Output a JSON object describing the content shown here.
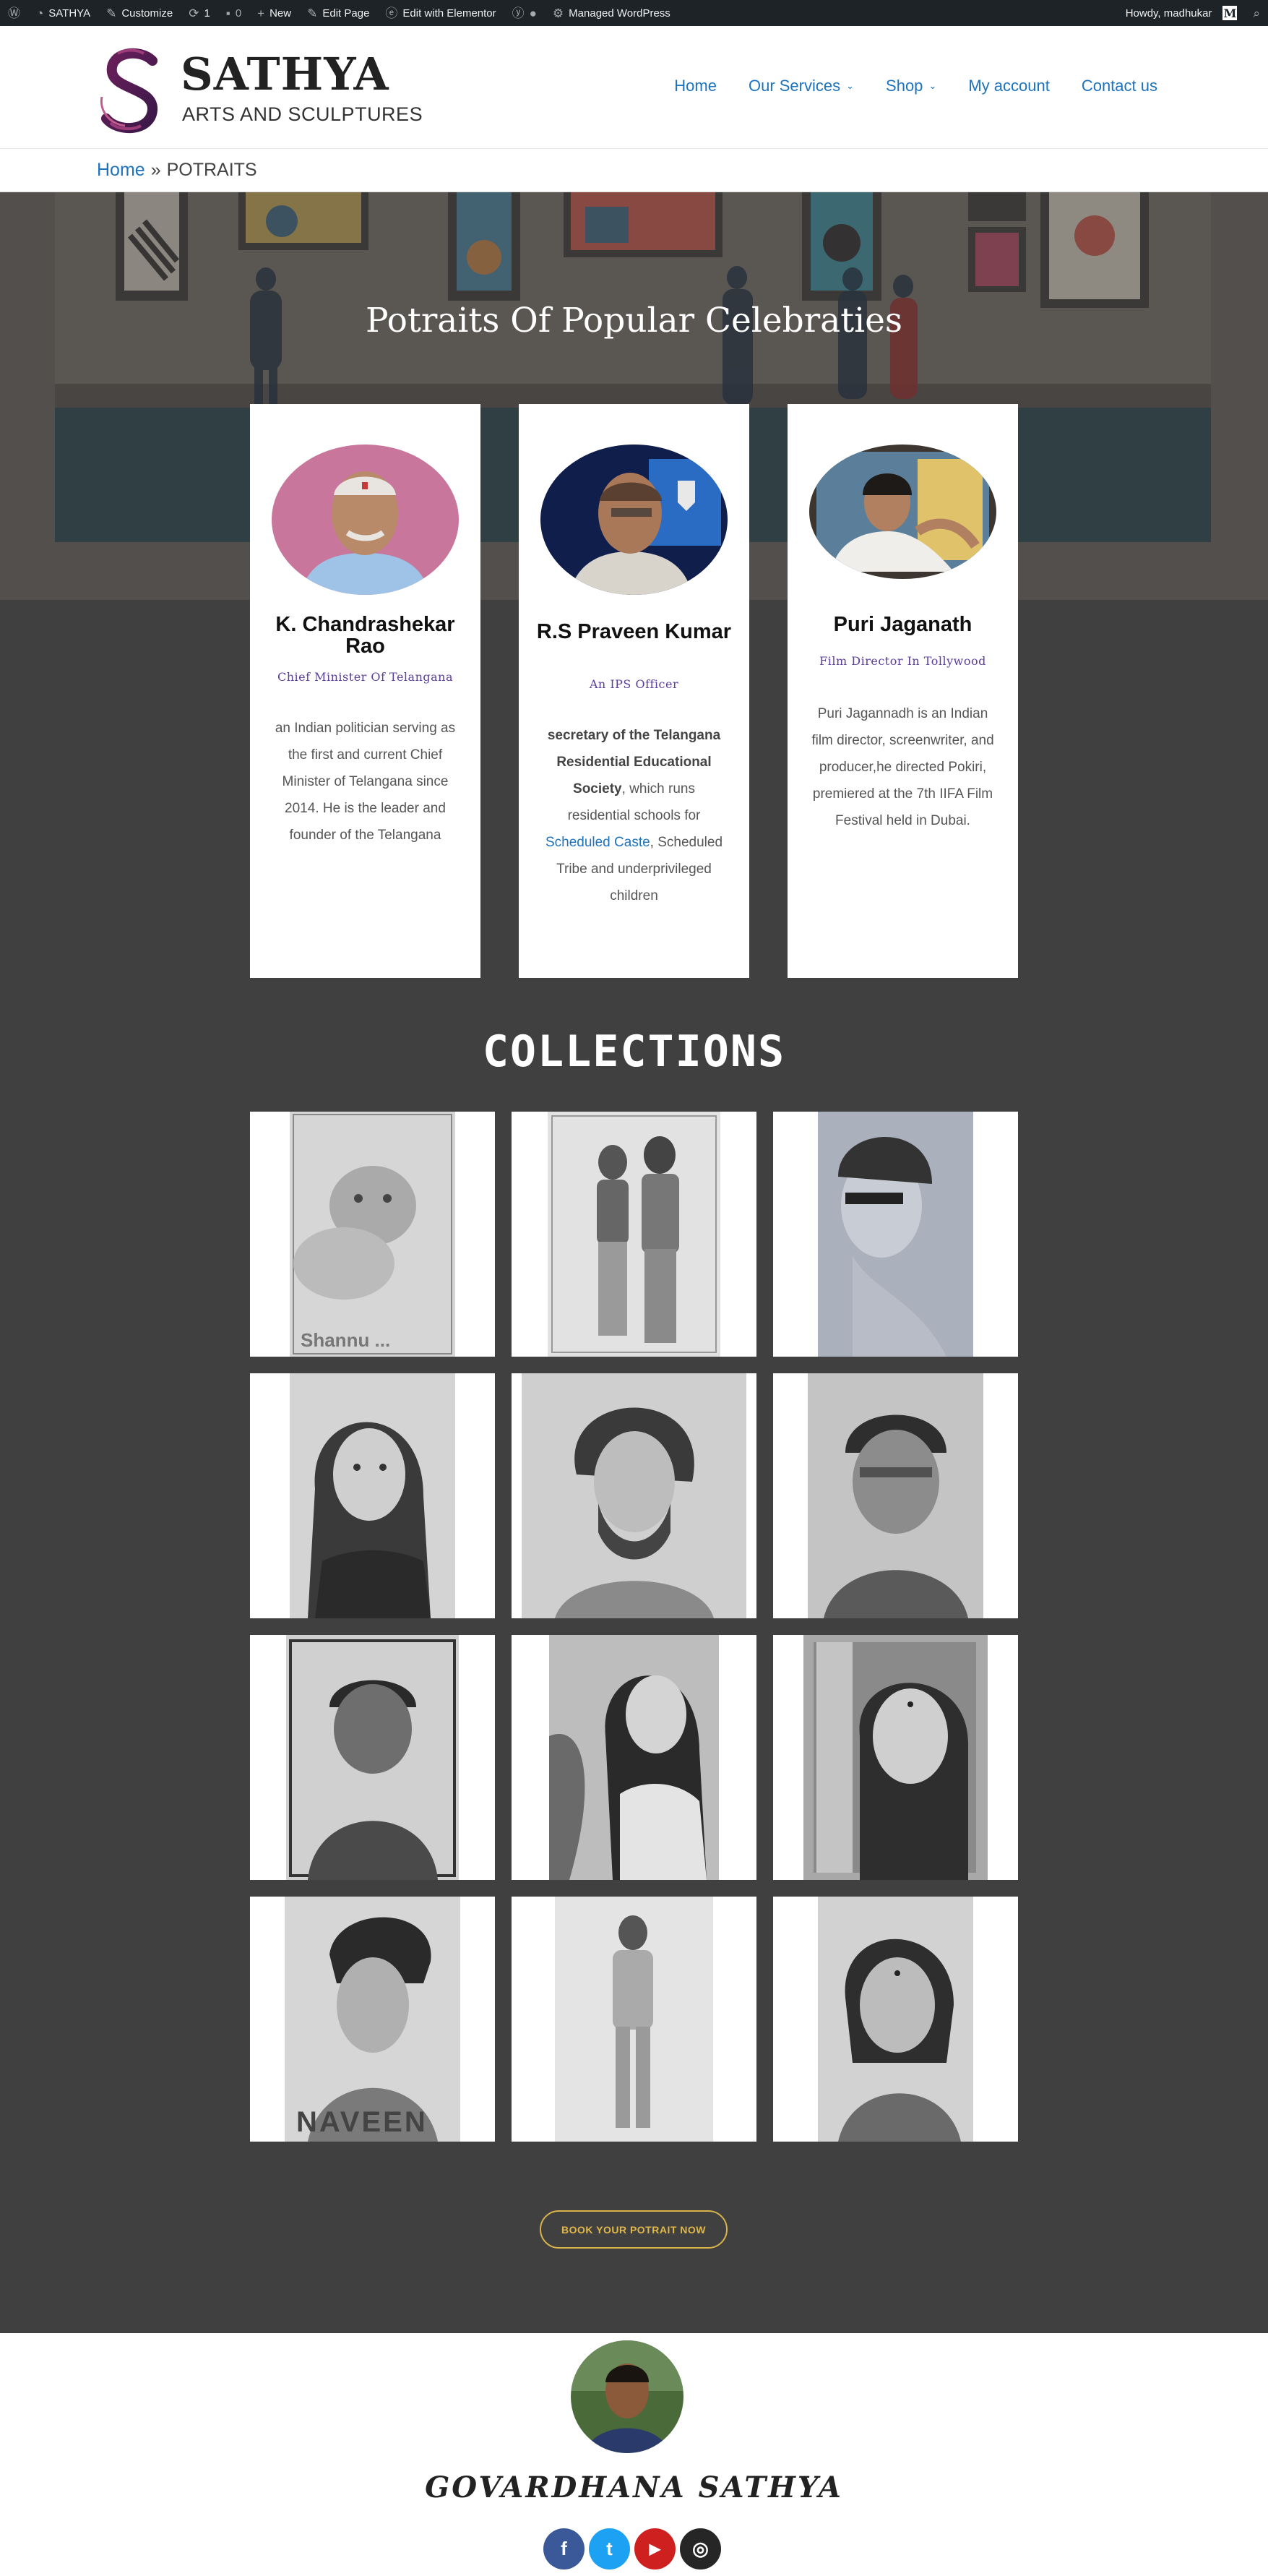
{
  "adminbar": {
    "site_name": "SATHYA",
    "customize": "Customize",
    "updates_count": "1",
    "comments_count": "0",
    "new_label": "New",
    "edit_page": "Edit Page",
    "edit_elementor": "Edit with Elementor",
    "managed_wp": "Managed WordPress",
    "howdy": "Howdy, madhukar",
    "avatar_letter": "M"
  },
  "header": {
    "title": "SATHYA",
    "tagline": "ARTS AND SCULPTURES",
    "logo_letter": "S",
    "nav": [
      {
        "label": "Home"
      },
      {
        "label": "Our Services"
      },
      {
        "label": "Shop"
      },
      {
        "label": "My account"
      },
      {
        "label": "Contact us"
      }
    ]
  },
  "breadcrumb": {
    "home": "Home",
    "separator": "»",
    "current": "POTRAITS"
  },
  "hero": {
    "title": "Potraits Of Popular Celebraties"
  },
  "celebrities": [
    {
      "name": "K. Chandrashekar Rao",
      "role": "Chief Minister Of Telangana",
      "desc": "an Indian politician serving as the first and current Chief Minister of Telangana since 2014. He is the leader and founder of the Telangana"
    },
    {
      "name": "R.S Praveen Kumar",
      "role": "An IPS Officer",
      "desc_bold": "secretary of the Telangana Residential Educational Society",
      "desc_mid": ", which runs residential schools for ",
      "desc_link": "Scheduled Caste",
      "desc_end": ", Scheduled Tribe and underprivileged children"
    },
    {
      "name": "Puri Jaganath",
      "role": "Film Director In Tollywood",
      "desc": "Puri Jagannadh is an Indian film director, screenwriter, and producer,he directed Pokiri, premiered at the 7th IIFA Film Festival held in Dubai."
    }
  ],
  "collections": {
    "title": "COLLECTIONS",
    "captions": [
      "Shannu ...",
      "NAVEEN"
    ]
  },
  "cta": {
    "label": "BOOK YOUR POTRAIT NOW"
  },
  "footer": {
    "name": "GOVARDHANA SATHYA",
    "social": [
      {
        "icon": "facebook-icon",
        "glyph": "f",
        "color": "#3b5998"
      },
      {
        "icon": "twitter-icon",
        "glyph": "t",
        "color": "#1da1f2"
      },
      {
        "icon": "youtube-icon",
        "glyph": "▶",
        "color": "#cd201f"
      },
      {
        "icon": "instagram-icon",
        "glyph": "◎",
        "color": "#262626"
      }
    ]
  },
  "colors": {
    "page_bg": "#404040",
    "link": "#1e73be",
    "accent_gold": "#d8b24a",
    "role_purple": "#5b3d9c"
  }
}
